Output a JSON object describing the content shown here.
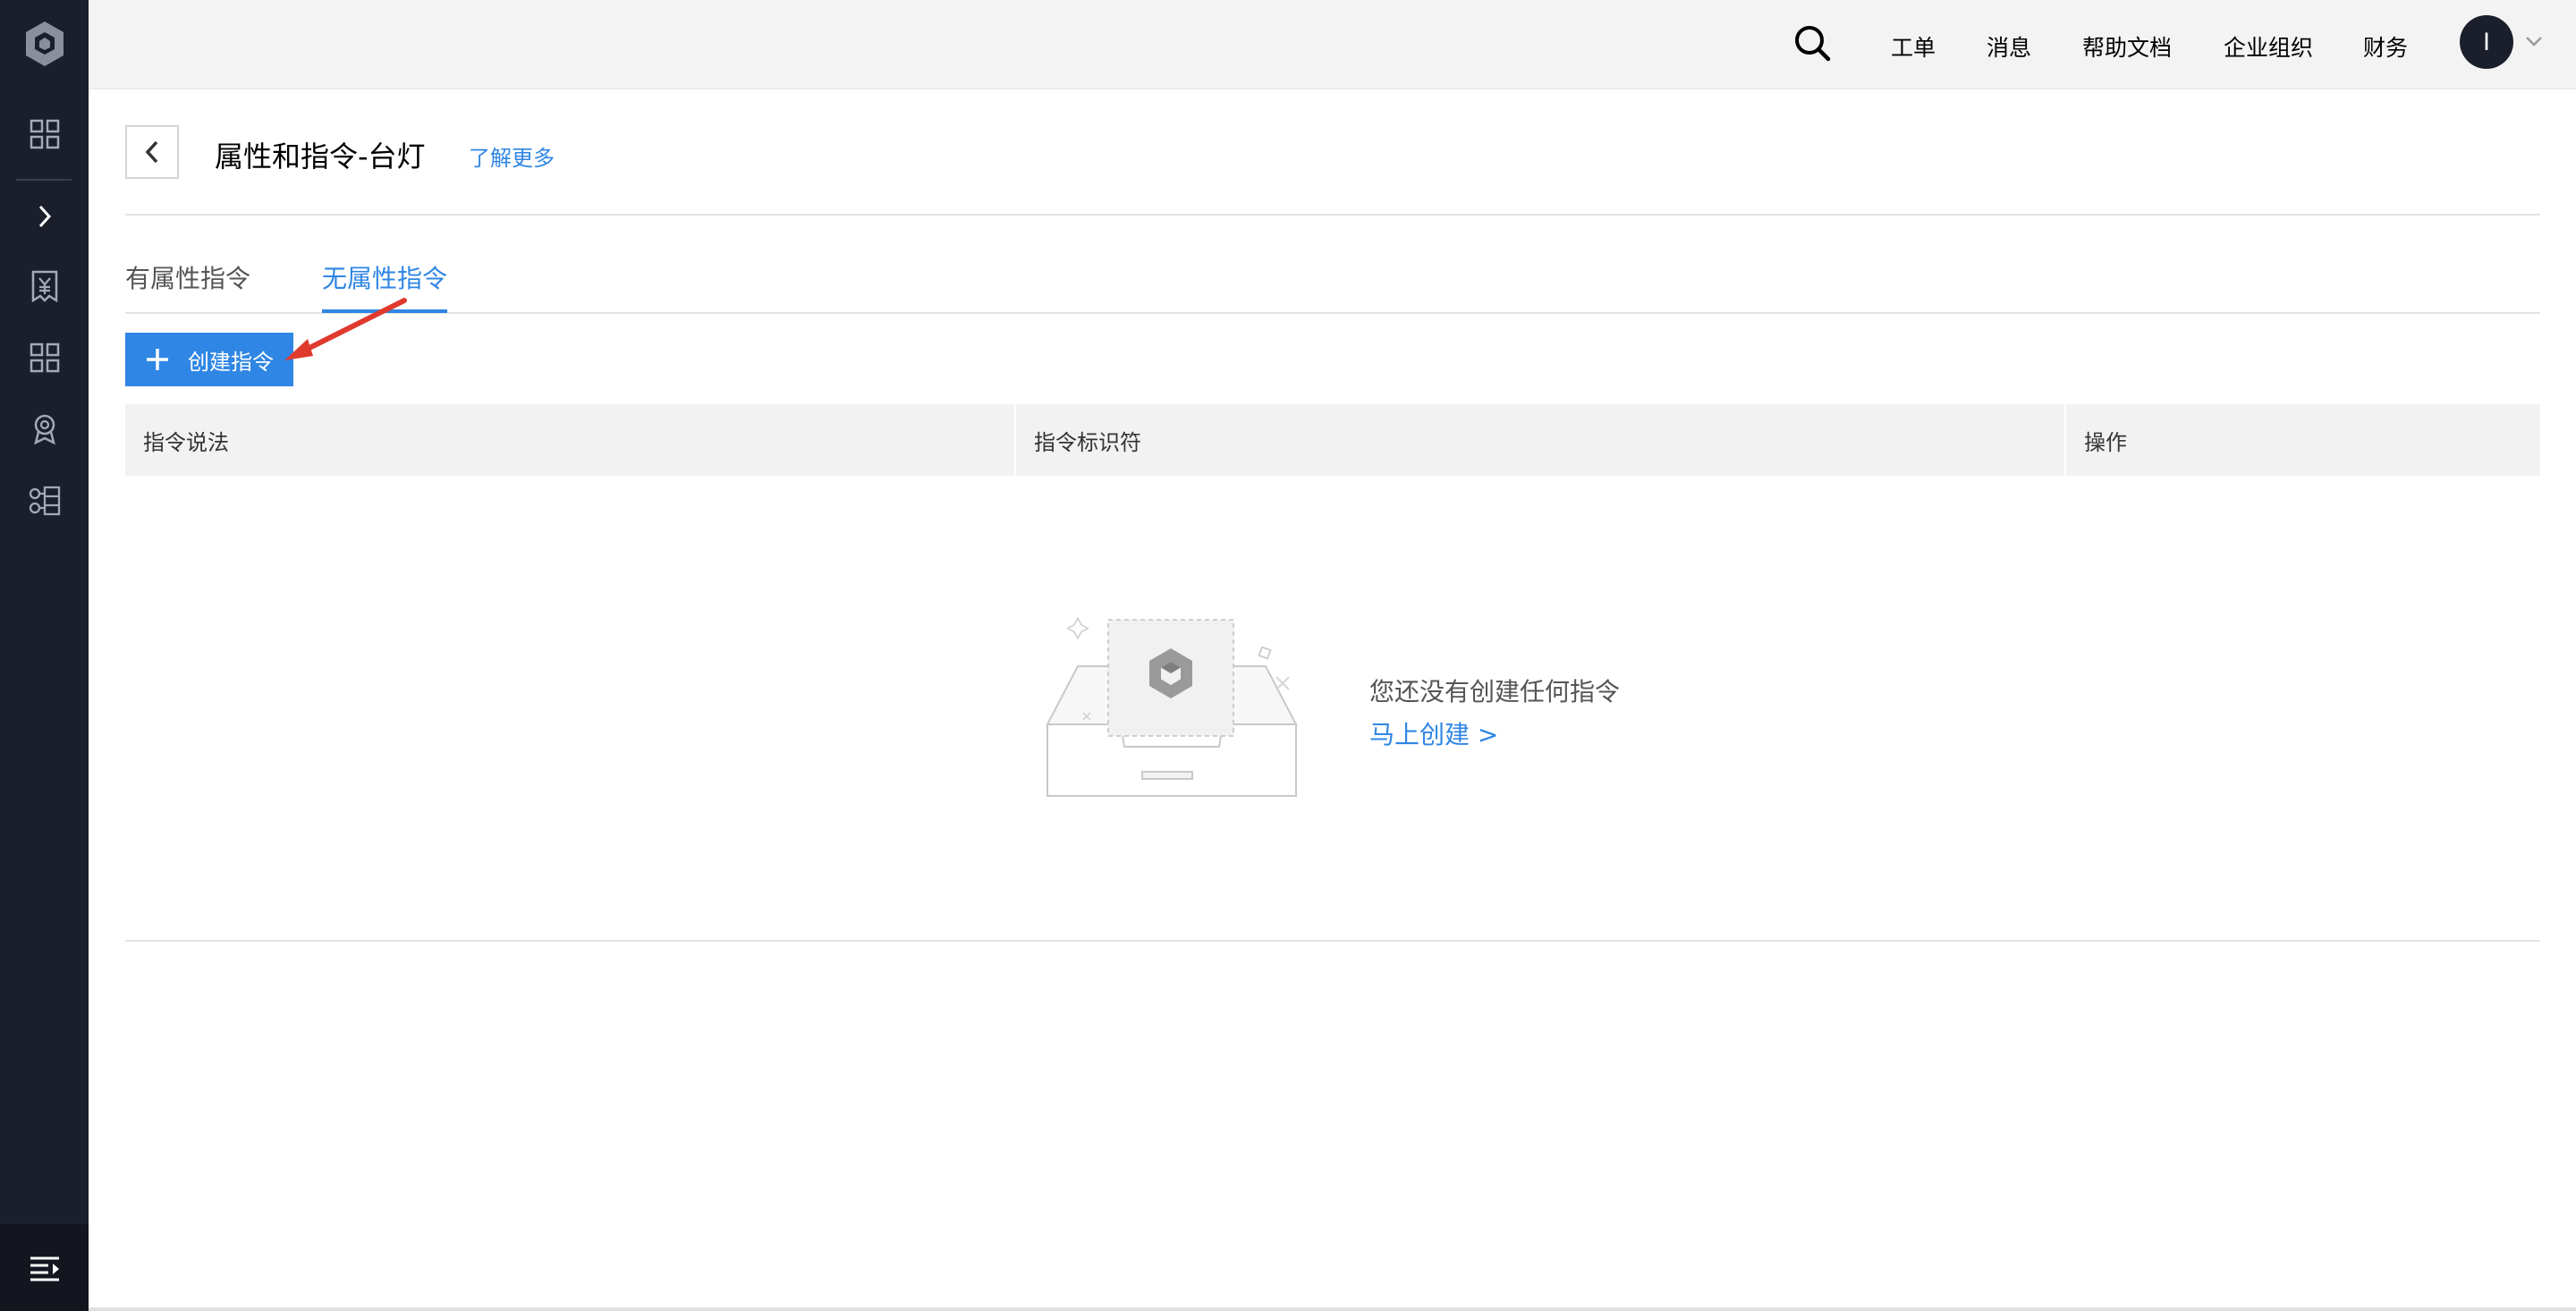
{
  "sidebar": {
    "items": [
      {
        "icon": "dashboard-grid-icon"
      },
      {
        "icon": "expand-chevron-icon"
      },
      {
        "icon": "billing-icon"
      },
      {
        "icon": "apps-grid-icon"
      },
      {
        "icon": "badge-icon"
      },
      {
        "icon": "workflow-icon"
      }
    ],
    "bottom_icon": "menu-collapse-icon"
  },
  "topbar": {
    "links": [
      "工单",
      "消息",
      "帮助文档",
      "企业组织",
      "财务"
    ],
    "avatar_initial": "I"
  },
  "header": {
    "title": "属性和指令-台灯",
    "learn_more": "了解更多"
  },
  "tabs": [
    {
      "label": "有属性指令",
      "active": false
    },
    {
      "label": "无属性指令",
      "active": true
    }
  ],
  "create_button": {
    "label": "创建指令"
  },
  "table": {
    "columns": [
      "指令说法",
      "指令标识符",
      "操作"
    ],
    "rows": []
  },
  "empty_state": {
    "message": "您还没有创建任何指令",
    "action": "马上创建 >"
  },
  "colors": {
    "accent": "#2f86e4",
    "sidebar_bg": "#1b1f2b",
    "annotation_arrow": "#e03a2f"
  }
}
